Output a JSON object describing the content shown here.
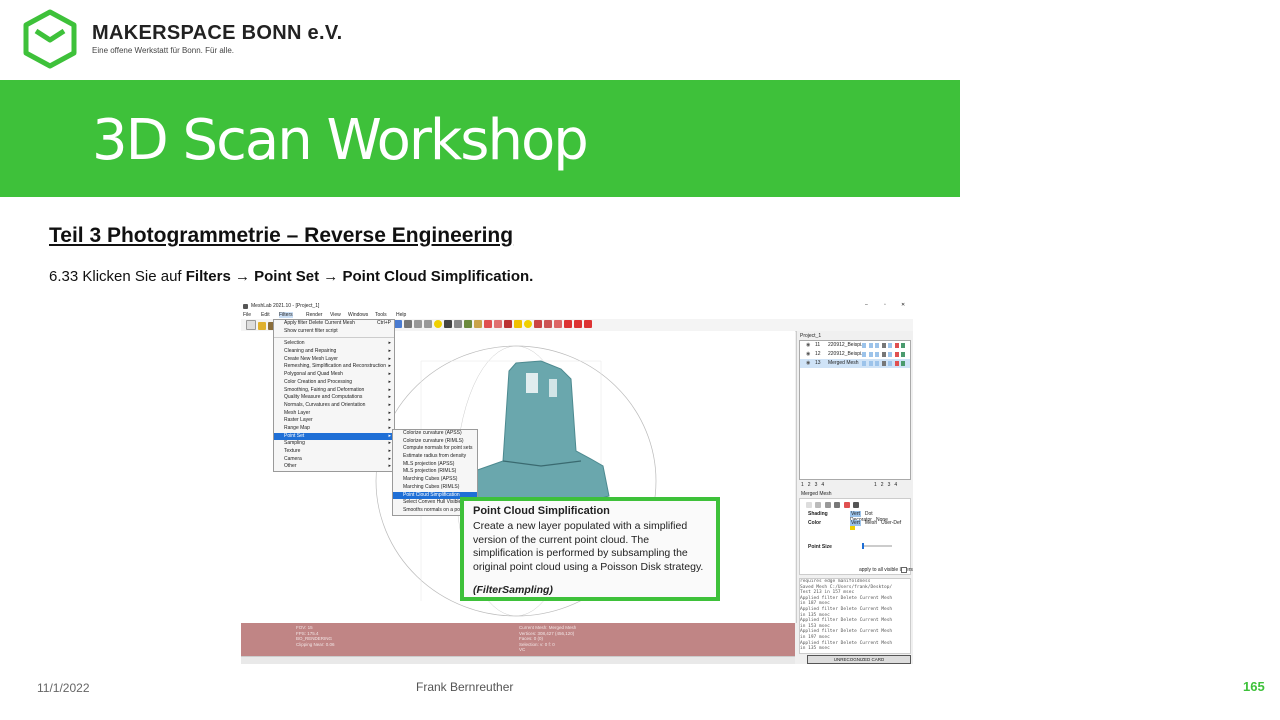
{
  "header": {
    "org_name": "MAKERSPACE BONN e.V.",
    "tagline": "Eine offene Werkstatt für Bonn. Für alle.",
    "title": "3D Scan Workshop"
  },
  "section": {
    "heading": "Teil 3  Photogrammetrie  – Reverse Engineering",
    "step_prefix": "6.33 Klicken Sie auf ",
    "step_filters": "Filters",
    "step_point_set": "Point Set",
    "step_simplification": "Point Cloud Simplification",
    "step_suffix": "."
  },
  "app": {
    "window_title": "MeshLab 2021.10 - [Project_1]",
    "menu_bar": [
      "File",
      "Edit",
      "Filters",
      "Render",
      "View",
      "Windows",
      "Tools",
      "Help"
    ],
    "filters_menu": {
      "top_items": [
        {
          "label": "Apply filter Delete Current Mesh",
          "shortcut": "Ctrl+P"
        },
        {
          "label": "Show current filter script",
          "shortcut": ""
        }
      ],
      "items": [
        "Selection",
        "Cleaning and Repairing",
        "Create New Mesh Layer",
        "Remeshing, Simplification and Reconstruction",
        "Polygonal and Quad Mesh",
        "Color Creation and Processing",
        "Smoothing, Fairing and Deformation",
        "Quality Measure and Computations",
        "Normals, Curvatures and Orientation",
        "Mesh Layer",
        "Raster Layer",
        "Range Map",
        "Point Set",
        "Sampling",
        "Texture",
        "Camera",
        "Other"
      ],
      "selected": "Point Set"
    },
    "point_set_submenu": [
      "Colorize curvature (APSS)",
      "Colorize curvature (RIMLS)",
      "Compute normals for point sets",
      "Estimate radius from density",
      "MLS projection (APSS)",
      "MLS projection (RIMLS)",
      "Marching Cubes (APSS)",
      "Marching Cubes (RIMLS)",
      "Point Cloud Simplification",
      "Select Convex Hull Visible Points",
      "Smooths normals on a point sets"
    ],
    "submenu_selected": "Point Cloud Simplification",
    "tooltip": {
      "title": "Point Cloud Simplification",
      "body": "Create a new layer populated with a simplified version of the current point cloud. The simplification is performed by subsampling the original point cloud using a Poisson Disk strategy.",
      "code": "(FilterSampling)"
    },
    "layers_panel": {
      "title": "Project_1",
      "layers": [
        {
          "id": "11",
          "name": "220912_Beispi..."
        },
        {
          "id": "12",
          "name": "220912_Beispi..."
        },
        {
          "id": "13",
          "name": "Merged Mesh"
        }
      ],
      "pages_left": [
        "1",
        "2",
        "3",
        "4"
      ],
      "pages_right": [
        "1",
        "2",
        "3",
        "4"
      ],
      "current_layer": "Merged Mesh",
      "shading_label": "Shading",
      "shading_options": [
        "Vert",
        "Dot Decorator",
        "None"
      ],
      "color_label": "Color",
      "color_options": [
        "Vert",
        "Mesh",
        "User-Def"
      ],
      "point_size_label": "Point Size",
      "apply_all_label": "apply to all visible layers"
    },
    "log": [
      "requires edge manifoldness",
      "Saved Mesh C:/Users/frank/Desktop/",
      "Test 213 in 157 msec",
      "Applied filter Delete Current Mesh",
      "in 187 msec",
      "Applied filter Delete Current Mesh",
      "in 135 msec",
      "Applied filter Delete Current Mesh",
      "in 153 msec",
      "Applied filter Delete Current Mesh",
      "in 197 msec",
      "Applied filter Delete Current Mesh",
      "in 135 msec"
    ],
    "status_left": [
      "FOV: 15",
      "FPS:  175.4",
      "BO_RENDERING",
      "Clipping Near:  0.06"
    ],
    "status_mid": [
      "Current Mesh: Merged Mesh",
      "Vertices: 308,427     (456,120)",
      "Faces: 0     (0)",
      "Selection: v: 0 f: 0",
      "VC"
    ],
    "unrecognized_button": "UNRECOGNIZED CARD"
  },
  "footer": {
    "date": "11/1/2022",
    "author": "Frank Bernreuther",
    "page": "165"
  },
  "colors": {
    "brand_green": "#3ec13a",
    "menu_highlight": "#1f6fd6",
    "status_bar": "#c08585",
    "point_cloud": "#6aa7ad"
  }
}
